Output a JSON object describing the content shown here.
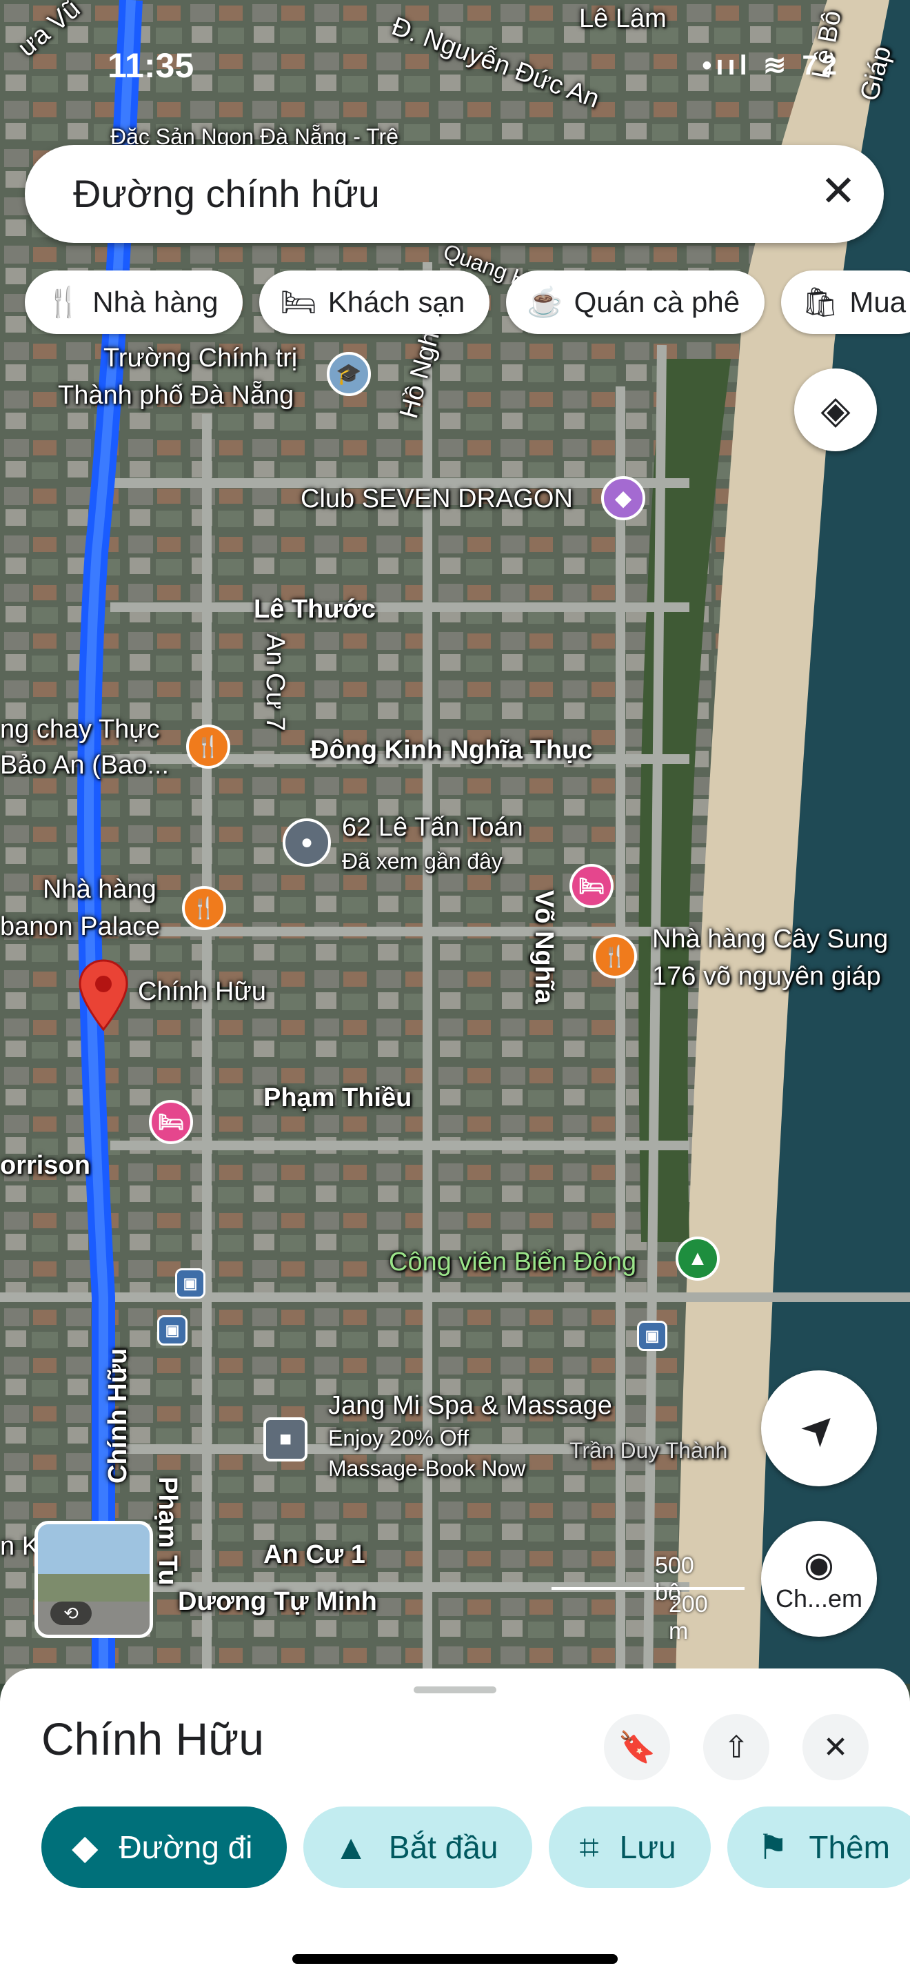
{
  "status_bar": {
    "time": "11:35",
    "icons": "•ııl  ≋  72"
  },
  "search": {
    "query": "Đường chính hữu",
    "close_icon": "✕"
  },
  "chips": [
    {
      "icon": "restaurant-icon",
      "glyph": "🍴",
      "label": "Nhà hàng"
    },
    {
      "icon": "hotel-icon",
      "glyph": "🛏",
      "label": "Khách sạn"
    },
    {
      "icon": "coffee-icon",
      "glyph": "☕",
      "label": "Quán cà phê"
    },
    {
      "icon": "shopping-icon",
      "glyph": "🛍",
      "label": "Mua"
    }
  ],
  "map_labels": {
    "top_place": "Đặc Sản Ngon Đà Nẵng - Trê",
    "street_le_lam": "Lê Lâm",
    "street_nguyen_duc_an": "Đ. Nguyễn Đức An",
    "street_le_bo": "Lê Bô",
    "street_giap": "Giáp",
    "street_vu": "ưa Vũ",
    "school_line1": "Trường Chính trị",
    "school_line2": "Thành phố Đà Nẵng",
    "ho_nghi": "Hồ Nghi",
    "quang_hu": "Quang Hu",
    "club": "Club SEVEN DRAGON",
    "le_thuoc": "Lê Thước",
    "an_cu_7": "An Cư 7",
    "dong_kinh": "Đông Kinh Nghĩa Thục",
    "veg_line1": "ng chay Thực",
    "veg_line2": "Bảo An (Bao...",
    "le_tan_toan": "62 Lê Tấn Toán",
    "recently_viewed": "Đã xem gần đây",
    "lebanon_line1": "Nhà hàng",
    "lebanon_line2": "banon Palace",
    "vo_nghia": "Võ Nghĩa",
    "cay_sung_line1": "Nhà hàng Cây Sung",
    "cay_sung_line2": "176 võ nguyên giáp",
    "chinh_huu": "Chính Hữu",
    "pham_thieu": "Phạm Thiều",
    "morrison": "orrison",
    "park": "Công viên Biển Đông",
    "chinh_huu_road": "Chính Hữu",
    "pham_tu": "Phạm Tu",
    "spa": "Jang Mi Spa & Massage",
    "spa_ad1": "Enjoy 20% Off",
    "spa_ad2": "Massage-Book Now",
    "tran_duy_thanh": "Trần Duy Thành",
    "an_cu_1": "An Cư 1",
    "duong_tu_minh": "Dương Tự Minh",
    "scale_ft": "500 bộ",
    "scale_m": "200 m",
    "lens_label": "Ch...em",
    "left_edge": "n K"
  },
  "sheet": {
    "title": "Chính Hữu",
    "actions": [
      {
        "icon": "directions-icon",
        "glyph": "◆",
        "label": "Đường đi"
      },
      {
        "icon": "navigation-icon",
        "glyph": "▲",
        "label": "Bắt đầu"
      },
      {
        "icon": "bookmark-icon",
        "glyph": "⌗",
        "label": "Lưu"
      },
      {
        "icon": "flag-icon",
        "glyph": "⚑",
        "label": "Thêm"
      }
    ]
  },
  "colors": {
    "route": "#1a5cff",
    "accent": "#00707a",
    "sea": "#1f4a55",
    "sand": "#d8cbb0"
  }
}
